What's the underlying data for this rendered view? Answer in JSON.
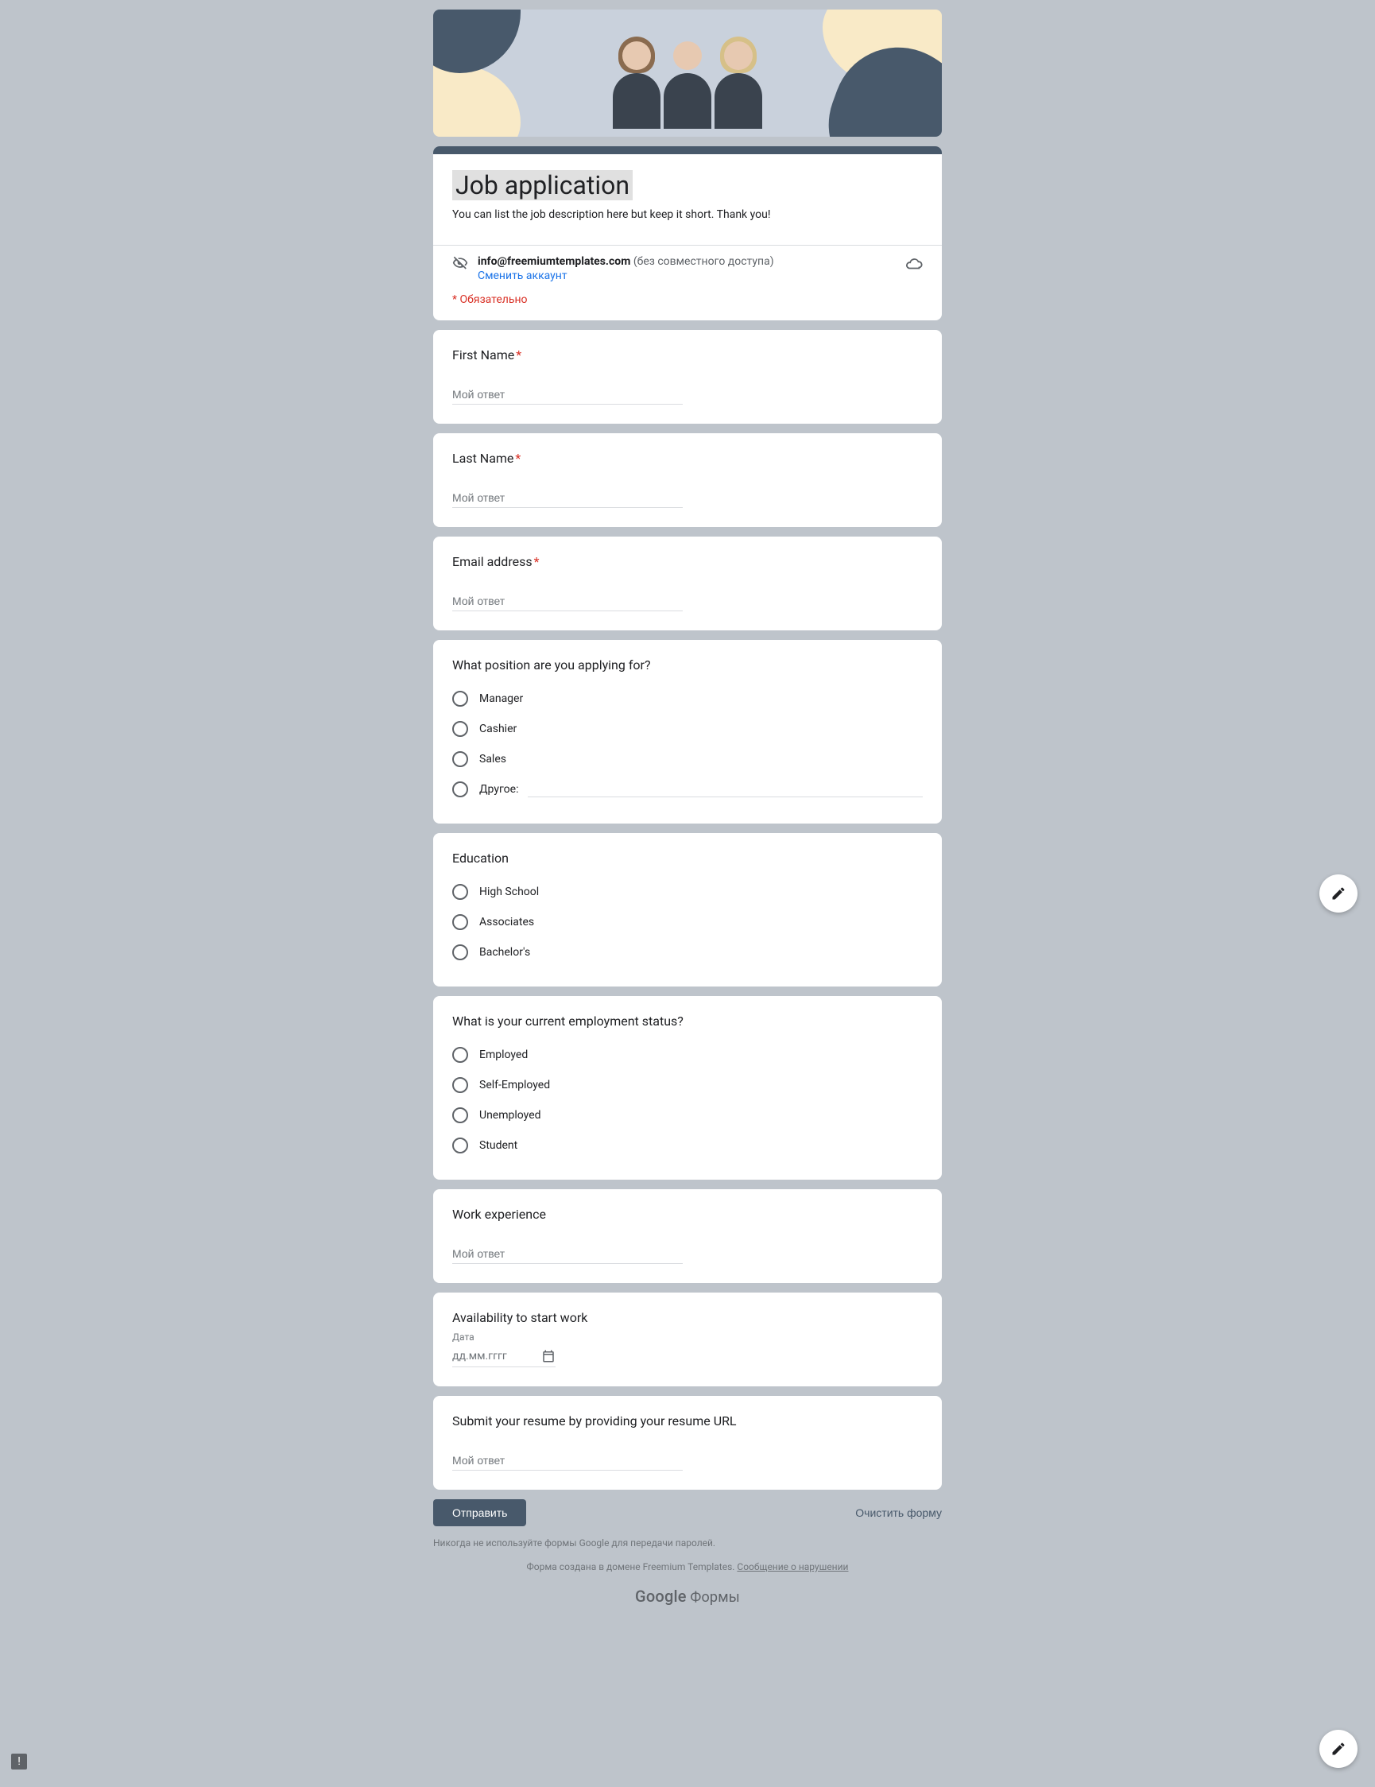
{
  "form": {
    "title": "Job application",
    "description": "You can list the job description here but keep it short. Thank you!"
  },
  "account": {
    "email": "info@freemiumtemplates.com",
    "no_share": "(без совместного доступа)",
    "switch_account": "Сменить аккаунт"
  },
  "required_note": "* Обязательно",
  "questions": {
    "first_name": {
      "label": "First Name",
      "required": true,
      "placeholder": "Мой ответ"
    },
    "last_name": {
      "label": "Last Name",
      "required": true,
      "placeholder": "Мой ответ"
    },
    "email": {
      "label": "Email address",
      "required": true,
      "placeholder": "Мой ответ"
    },
    "position": {
      "label": "What position are you applying for?",
      "options": [
        "Manager",
        "Cashier",
        "Sales"
      ],
      "other_label": "Другое:"
    },
    "education": {
      "label": "Education",
      "options": [
        "High School",
        "Associates",
        "Bachelor's"
      ]
    },
    "employment": {
      "label": "What is your current employment status?",
      "options": [
        "Employed",
        "Self-Employed",
        "Unemployed",
        "Student"
      ]
    },
    "work_exp": {
      "label": "Work experience",
      "placeholder": "Мой ответ"
    },
    "availability": {
      "label": "Availability to start work",
      "date_label": "Дата",
      "date_placeholder": "дд.мм.гггг"
    },
    "resume": {
      "label": "Submit your resume by providing your resume URL",
      "placeholder": "Мой ответ"
    }
  },
  "actions": {
    "submit": "Отправить",
    "clear": "Очистить форму"
  },
  "footer": {
    "disclaimer": "Никогда не используйте формы Google для передачи паролей.",
    "domain_prefix": "Форма создана в домене Freemium Templates. ",
    "report_abuse": "Сообщение о нарушении",
    "brand_google": "Google",
    "brand_forms": " Формы"
  }
}
